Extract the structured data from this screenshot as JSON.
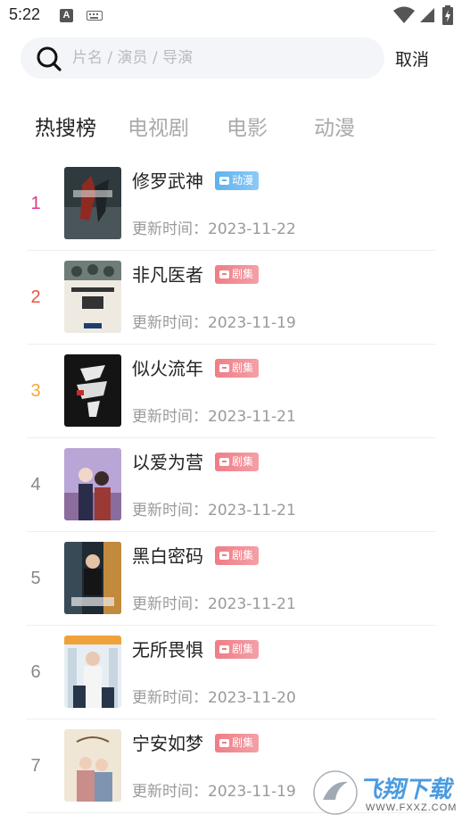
{
  "status": {
    "time": "5:22",
    "a_icon": "A"
  },
  "search": {
    "placeholder": "片名 / 演员 / 导演",
    "value": "",
    "cancel_label": "取消"
  },
  "tabs": [
    {
      "label": "热搜榜",
      "active": true
    },
    {
      "label": "电视剧",
      "active": false
    },
    {
      "label": "电影",
      "active": false
    },
    {
      "label": "动漫",
      "active": false
    }
  ],
  "list": [
    {
      "rank": "1",
      "rank_color": "#e2358a",
      "title": "修罗武神",
      "badge": "动漫",
      "badge_type": "anime",
      "update": "更新时间：2023-11-22"
    },
    {
      "rank": "2",
      "rank_color": "#e8553f",
      "title": "非凡医者",
      "badge": "剧集",
      "badge_type": "drama",
      "update": "更新时间：2023-11-19"
    },
    {
      "rank": "3",
      "rank_color": "#f3a83b",
      "title": "似火流年",
      "badge": "剧集",
      "badge_type": "drama",
      "update": "更新时间：2023-11-21"
    },
    {
      "rank": "4",
      "rank_color": "#888888",
      "title": "以爱为营",
      "badge": "剧集",
      "badge_type": "drama",
      "update": "更新时间：2023-11-21"
    },
    {
      "rank": "5",
      "rank_color": "#888888",
      "title": "黑白密码",
      "badge": "剧集",
      "badge_type": "drama",
      "update": "更新时间：2023-11-21"
    },
    {
      "rank": "6",
      "rank_color": "#888888",
      "title": "无所畏惧",
      "badge": "剧集",
      "badge_type": "drama",
      "update": "更新时间：2023-11-20"
    },
    {
      "rank": "7",
      "rank_color": "#888888",
      "title": "宁安如梦",
      "badge": "剧集",
      "badge_type": "drama",
      "update": "更新时间：2023-11-19"
    }
  ],
  "watermark": {
    "name": "飞翔下载",
    "url": "WWW.FXXZ.COM"
  }
}
